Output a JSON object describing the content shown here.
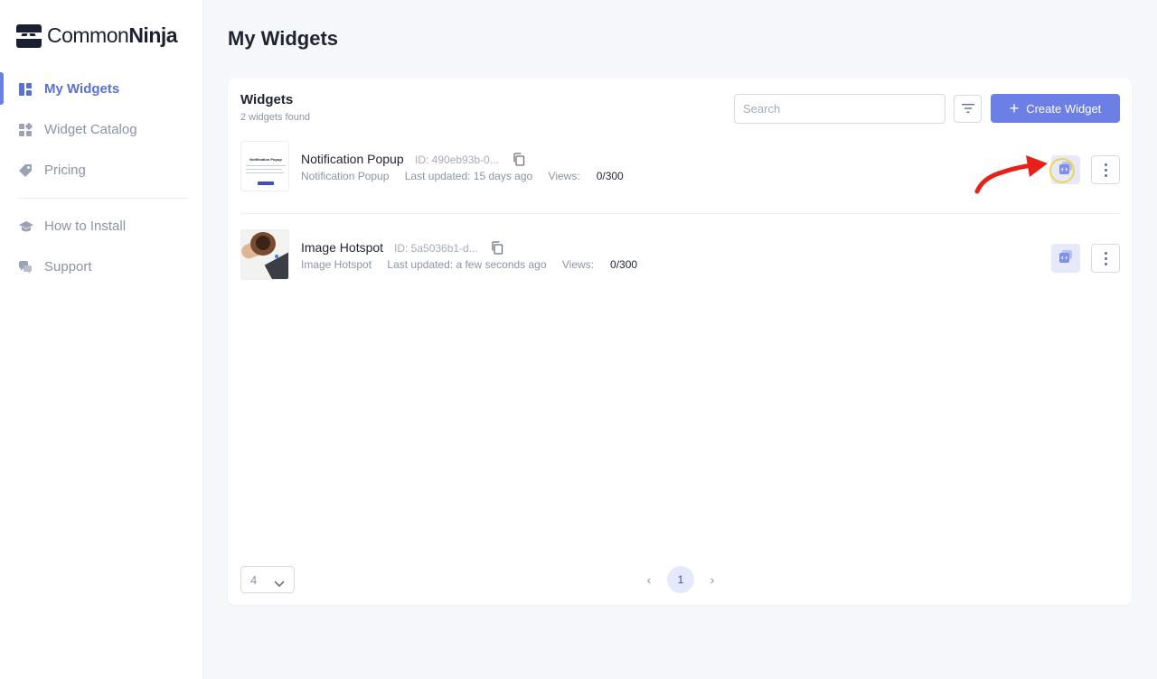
{
  "brand": {
    "name_part1": "Common",
    "name_part2": "Ninja"
  },
  "sidebar": {
    "items": [
      {
        "label": "My Widgets",
        "icon": "dashboard-icon",
        "active": true
      },
      {
        "label": "Widget Catalog",
        "icon": "catalog-grid-icon",
        "active": false
      },
      {
        "label": "Pricing",
        "icon": "price-tag-icon",
        "active": false
      },
      {
        "label": "How to Install",
        "icon": "graduation-cap-icon",
        "active": false
      },
      {
        "label": "Support",
        "icon": "chat-bubbles-icon",
        "active": false
      }
    ]
  },
  "page": {
    "title": "My Widgets"
  },
  "widgets_panel": {
    "title": "Widgets",
    "subtitle": "2 widgets found",
    "search_placeholder": "Search",
    "create_label": "Create Widget",
    "rows": [
      {
        "name": "Notification Popup",
        "id": "ID: 490eb93b-0...",
        "type": "Notification Popup",
        "updated": "Last updated: 15 days ago",
        "views_label": "Views:",
        "views_value": "0/300",
        "thumb_title": "Notification Popup"
      },
      {
        "name": "Image Hotspot",
        "id": "ID: 5a5036b1-d...",
        "type": "Image Hotspot",
        "updated": "Last updated: a few seconds ago",
        "views_label": "Views:",
        "views_value": "0/300"
      }
    ]
  },
  "pagination": {
    "per_page": "4",
    "current_page": "1",
    "prev": "‹",
    "next": "›"
  },
  "colors": {
    "accent": "#6b7fe6",
    "annotation_arrow": "#e8201a",
    "highlight_ring": "#f0d54a"
  }
}
